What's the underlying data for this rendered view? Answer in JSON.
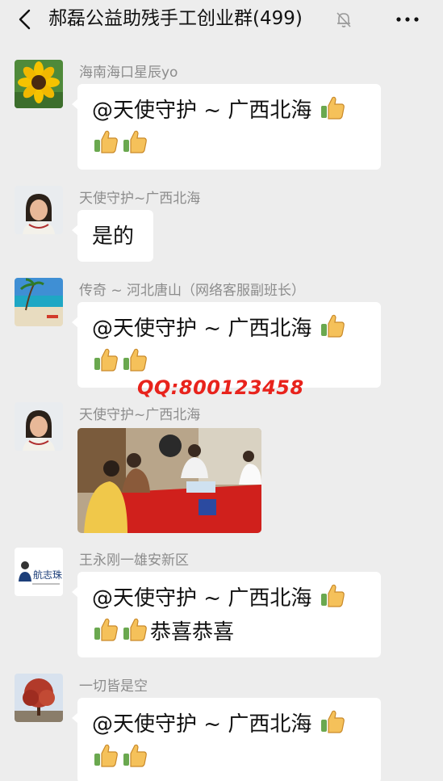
{
  "header": {
    "title": "郝磊公益助残手工创业群(499)"
  },
  "messages": [
    {
      "sender": "海南海口星辰yo",
      "line1": "@天使守护 ~ 广西北海",
      "line2": ""
    },
    {
      "sender": "天使守护~广西北海",
      "text": "是的"
    },
    {
      "sender": "传奇 ~ 河北唐山（网络客服副班长）",
      "line1": "@天使守护 ~ 广西北海",
      "line2": ""
    },
    {
      "sender": "天使守护~广西北海"
    },
    {
      "sender": "王永刚一雄安新区",
      "line1": "@天使守护 ~ 广西北海",
      "line2": "恭喜恭喜"
    },
    {
      "sender": "一切皆是空",
      "line1": "@天使守护 ~ 广西北海",
      "line2": ""
    }
  ],
  "avatar5_logo_text": "航志珠",
  "watermark": "QQ:800123458",
  "colors": {
    "background": "#ededed",
    "bubble": "#ffffff",
    "sender": "#8c8c8c",
    "watermark": "#e8231c"
  },
  "icons": [
    "back-arrow-icon",
    "mute-bell-icon",
    "more-icon",
    "thumbs-up-emoji"
  ]
}
